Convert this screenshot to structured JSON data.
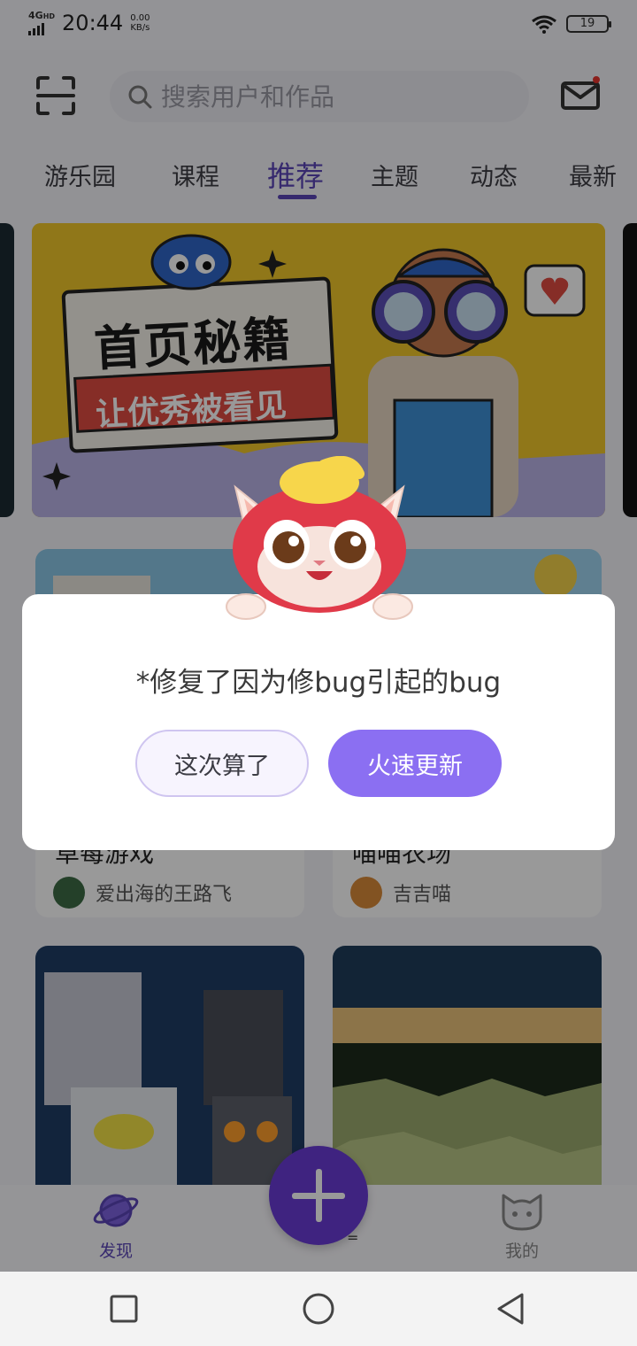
{
  "status_bar": {
    "network": "4G",
    "network_sup": "HD",
    "time": "20:44",
    "speed_value": "0.00",
    "speed_unit": "KB/s",
    "battery": "19"
  },
  "header": {
    "search_placeholder": "搜索用户和作品",
    "has_unread_mail": true
  },
  "tabs": [
    {
      "label": "游乐园",
      "active": false
    },
    {
      "label": "课程",
      "active": false
    },
    {
      "label": "推荐",
      "active": true
    },
    {
      "label": "主题",
      "active": false
    },
    {
      "label": "动态",
      "active": false
    },
    {
      "label": "最新",
      "active": false
    }
  ],
  "banner": {
    "title": "首页秘籍",
    "subtitle": "让优秀被看见"
  },
  "cards": [
    {
      "title": "草莓游戏",
      "author": "爱出海的王路飞"
    },
    {
      "title": "喵喵农场",
      "author": "吉吉喵"
    },
    {
      "title": "",
      "author": ""
    },
    {
      "title": "",
      "author": ""
    }
  ],
  "bottom_nav": {
    "discover": "发现",
    "mine": "我的",
    "mid_label": "="
  },
  "dialog": {
    "message": "*修复了因为修bug引起的bug",
    "cancel_label": "这次算了",
    "confirm_label": "火速更新"
  },
  "colors": {
    "accent": "#5a45b7",
    "dialog_primary": "#8b6ff2",
    "fab": "#6a3bd6"
  }
}
